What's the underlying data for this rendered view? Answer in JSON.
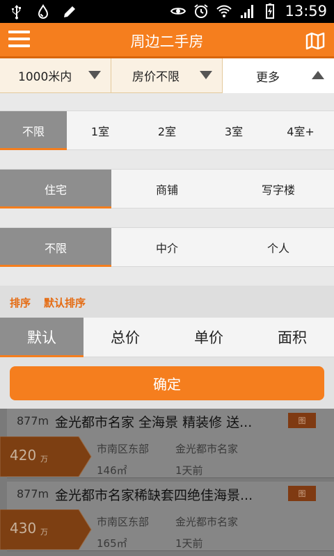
{
  "status_bar": {
    "time": "13:59"
  },
  "header": {
    "title": "周边二手房"
  },
  "filters": [
    {
      "label": "1000米内"
    },
    {
      "label": "房价不限"
    },
    {
      "label": "更多"
    }
  ],
  "rooms": {
    "options": [
      "不限",
      "1室",
      "2室",
      "3室",
      "4室+"
    ],
    "selected": "不限"
  },
  "property_types": {
    "options": [
      "住宅",
      "商铺",
      "写字楼"
    ],
    "selected": "住宅"
  },
  "sources": {
    "options": [
      "不限",
      "中介",
      "个人"
    ],
    "selected": "不限"
  },
  "sort": {
    "label": "排序",
    "current": "默认排序",
    "options": [
      "默认",
      "总价",
      "单价",
      "面积"
    ],
    "selected": "默认"
  },
  "confirm_label": "确定",
  "listings": [
    {
      "distance": "877m",
      "title": "金光都市名家 全海景 精装修 送...",
      "tag": "图",
      "price": "420",
      "price_unit": "万",
      "district": "市南区东部",
      "estate": "金光都市名家",
      "area": "146㎡",
      "time": "1天前"
    },
    {
      "distance": "877m",
      "title": "金光都市名家稀缺套四绝佳海景...",
      "tag": "图",
      "price": "430",
      "price_unit": "万",
      "district": "市南区东部",
      "estate": "金光都市名家",
      "area": "165㎡",
      "time": "1天前"
    }
  ],
  "colors": {
    "accent": "#f57e1e",
    "selected_bg": "#8e8e8e",
    "sort_text": "#e56b12"
  }
}
